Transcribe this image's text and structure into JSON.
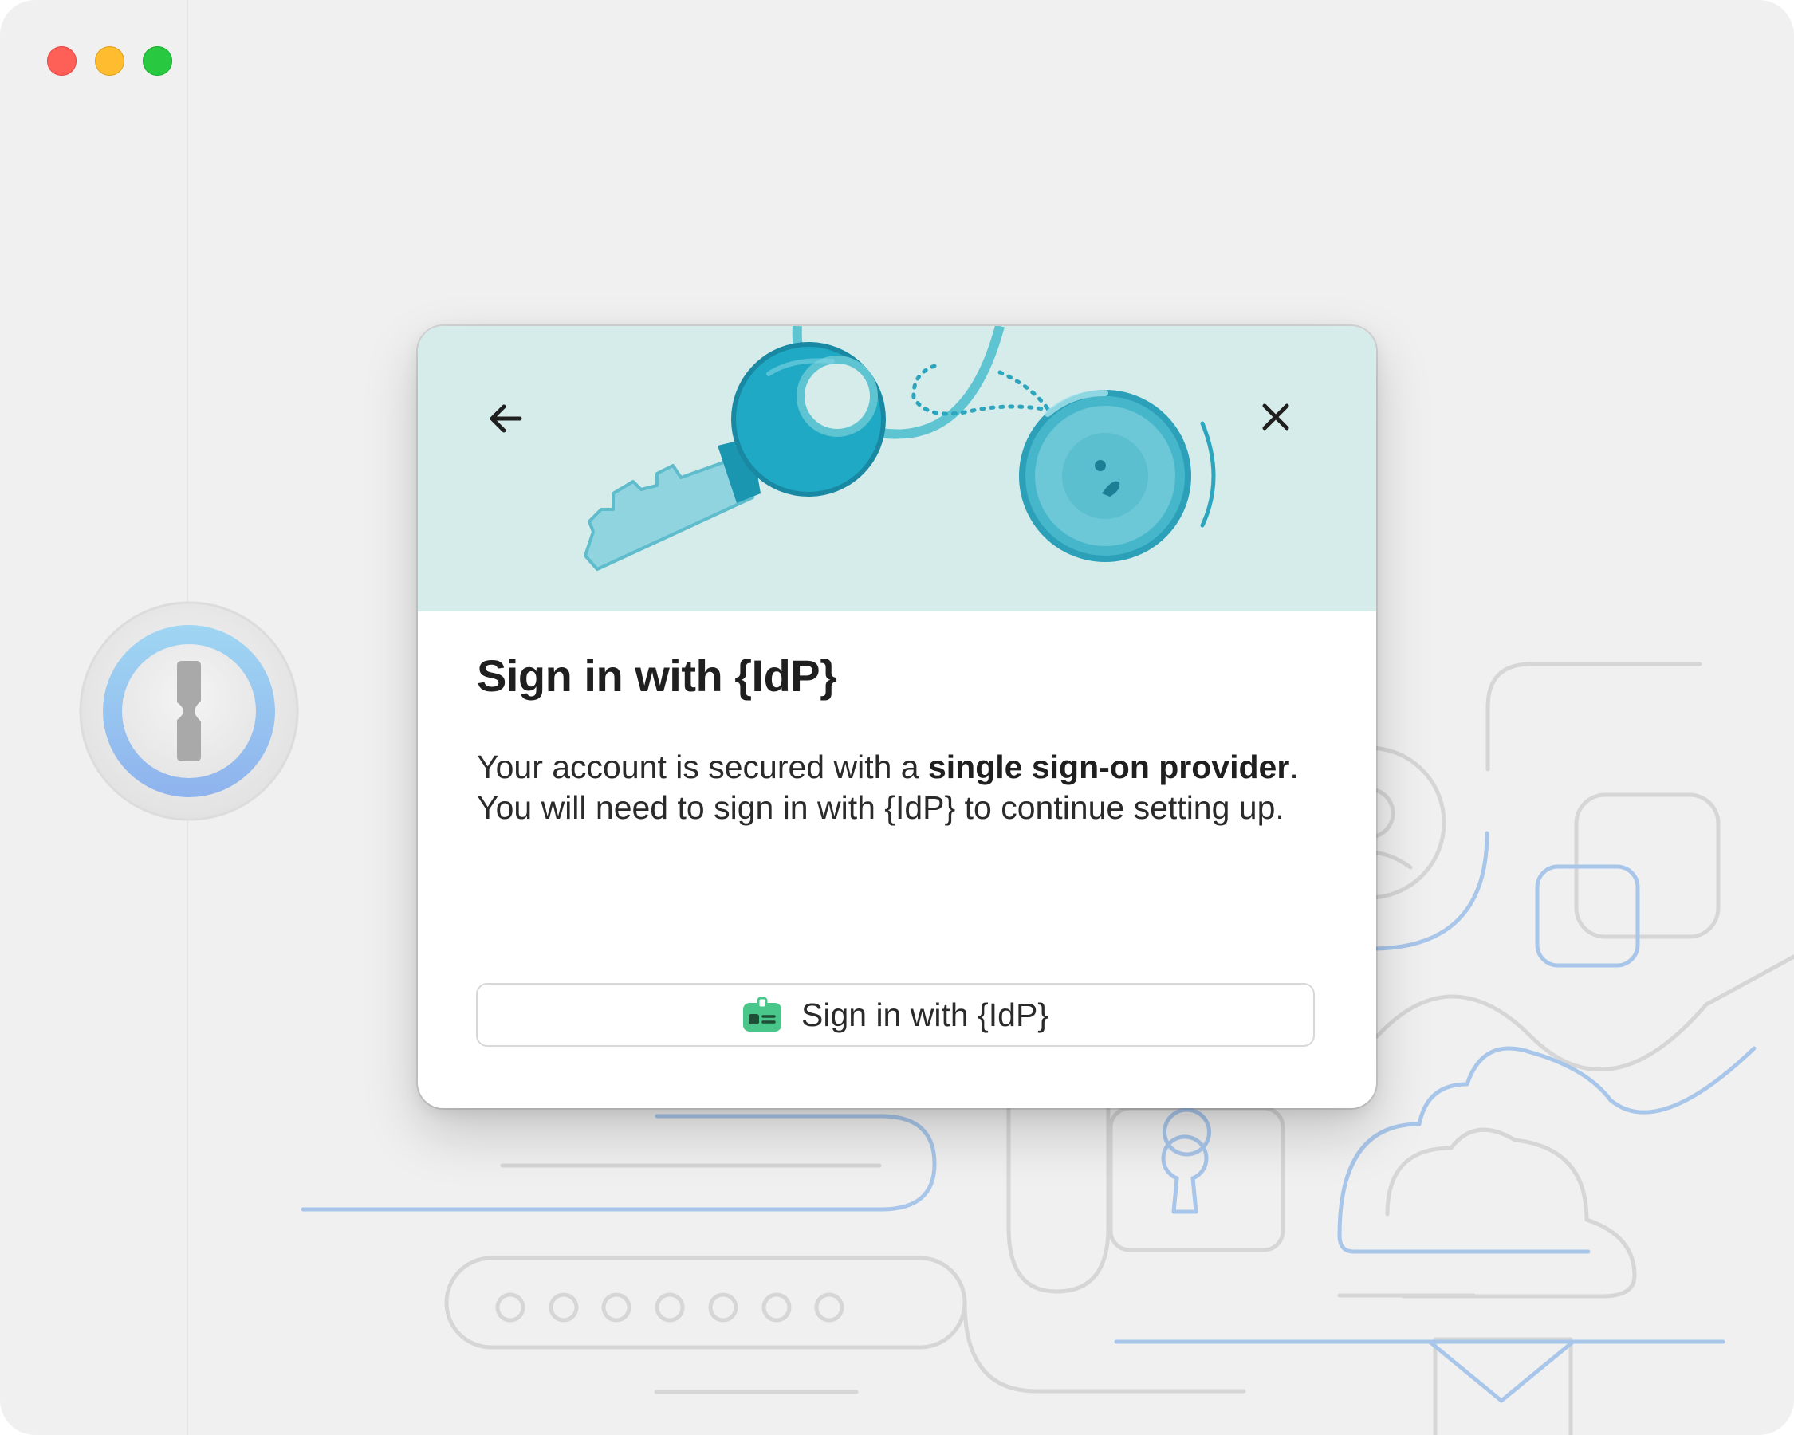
{
  "window": {
    "traffic_lights": {
      "close_color": "#fe5f57",
      "minimize_color": "#febc2e",
      "maximize_color": "#28c840"
    }
  },
  "app": {
    "logo_icon": "keyhole-logo-icon"
  },
  "dialog": {
    "back_icon": "arrow-left-icon",
    "close_icon": "close-x-icon",
    "hero_icon": "key-and-fob-illustration",
    "title": "Sign in with {IdP}",
    "body_part1": "Your account is secured with a ",
    "body_bold": "single sign-on provider",
    "body_part2": ". You will need to sign in with {IdP} to continue setting up.",
    "button_icon": "id-badge-icon",
    "button_label": "Sign in with {IdP}"
  },
  "colors": {
    "hero_bg": "#d5ecea",
    "accent_teal": "#2ba6be",
    "badge_green": "#49c689",
    "bg_line_blue": "#a8c6ea",
    "bg_line_gray": "#d6d6d6"
  }
}
